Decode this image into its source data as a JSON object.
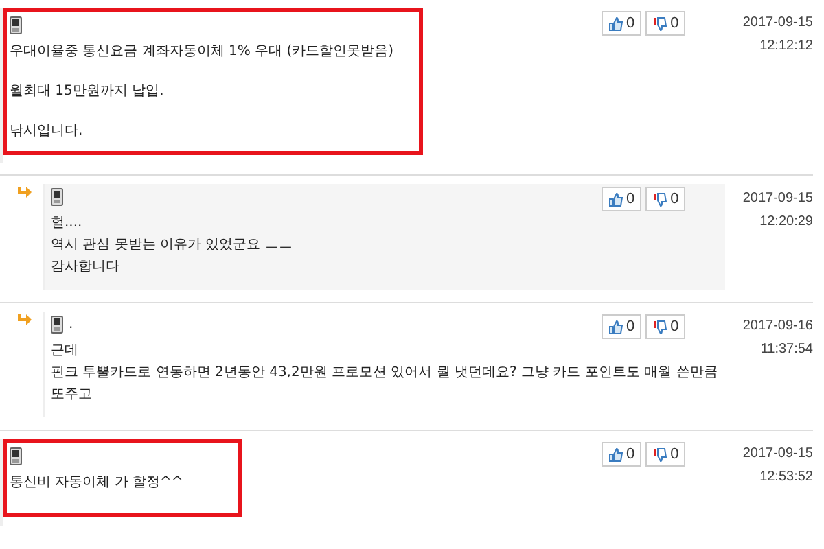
{
  "comments": [
    {
      "reply": false,
      "shaded": false,
      "highlighted": true,
      "paragraphs": [
        [
          "우대이율중 통신요금 계좌자동이체 1% 우대 (카드할인못받음)"
        ],
        [
          "월최대 15만원까지 납입."
        ],
        [
          "낚시입니다."
        ]
      ],
      "likes": "0",
      "dislikes": "0",
      "date": "2017-09-15",
      "time": "12:12:12"
    },
    {
      "reply": true,
      "shaded": true,
      "highlighted": false,
      "paragraphs": [
        [
          "헐....",
          "역시 관심 못받는 이유가 있었군요 ㅡㅡ",
          "감사합니다"
        ]
      ],
      "likes": "0",
      "dislikes": "0",
      "date": "2017-09-15",
      "time": "12:20:29"
    },
    {
      "reply": true,
      "shaded": false,
      "highlighted": false,
      "author": ".",
      "paragraphs": [
        [
          "근데",
          "핀크 투뿔카드로 연동하면 2년동안 43,2만원 프로모션 있어서 뭘 냇던데요? 그냥 카드 포인트도 매월 쓴만큼",
          "또주고"
        ]
      ],
      "likes": "0",
      "dislikes": "0",
      "date": "2017-09-16",
      "time": "11:37:54"
    },
    {
      "reply": false,
      "shaded": false,
      "highlighted": true,
      "paragraphs": [
        [
          "통신비 자동이체 가 할정^^"
        ]
      ],
      "likes": "0",
      "dislikes": "0",
      "date": "2017-09-15",
      "time": "12:53:52"
    }
  ]
}
